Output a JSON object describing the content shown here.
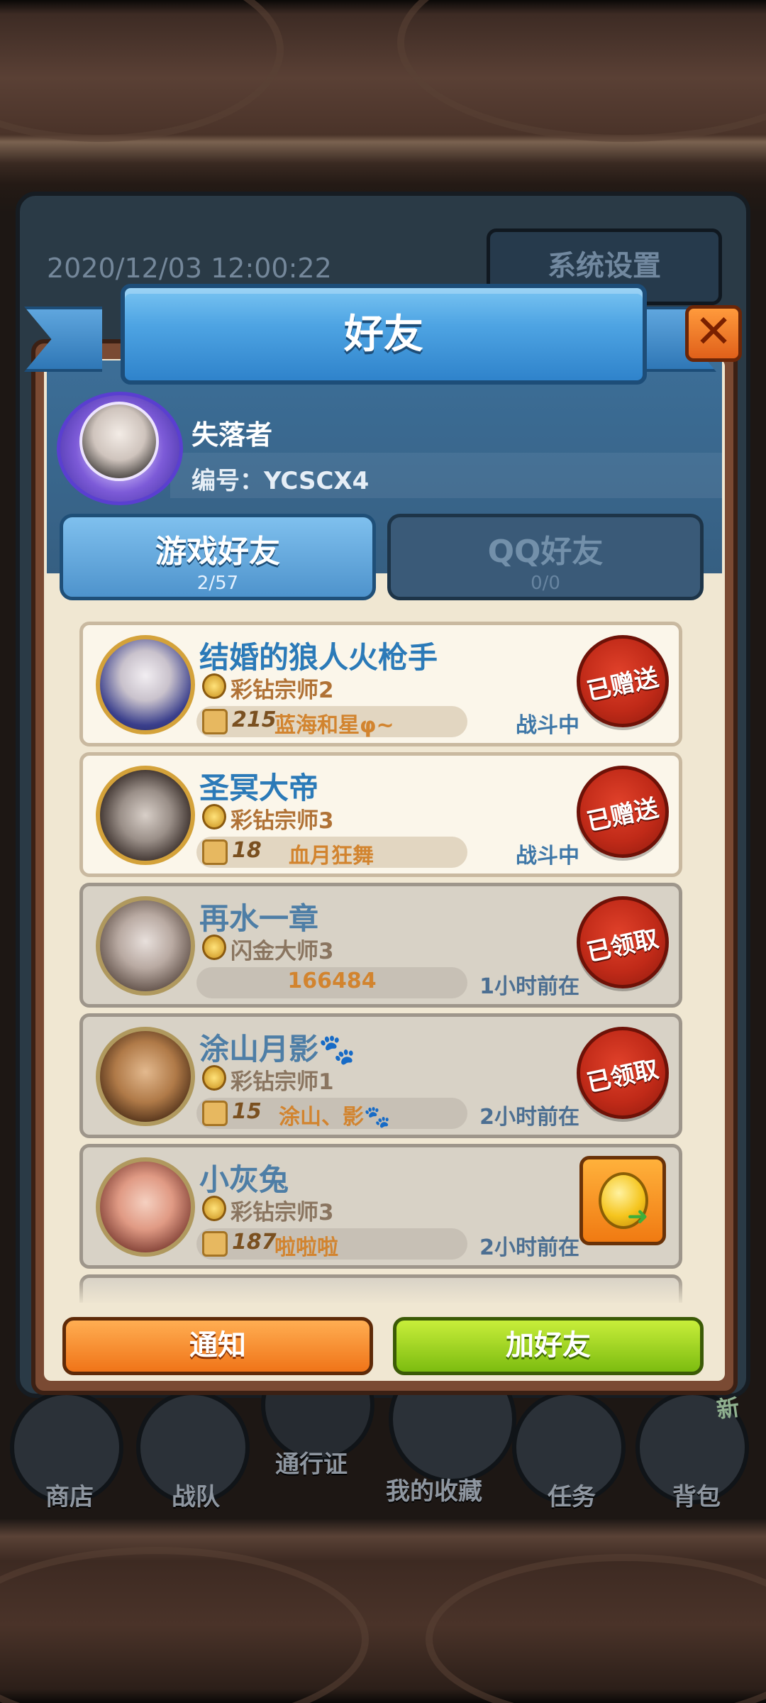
{
  "background": {
    "datetime": "2020/12/03 12:00:22",
    "settings_label": "系统设置",
    "nav": [
      {
        "label": "商店",
        "icon": "shop-icon"
      },
      {
        "label": "战队",
        "icon": "team-icon"
      },
      {
        "label": "通行证",
        "icon": "pass-icon"
      },
      {
        "label": "我的收藏",
        "icon": "collection-icon"
      },
      {
        "label": "任务",
        "icon": "task-icon"
      },
      {
        "label": "背包",
        "icon": "backpack-icon"
      }
    ],
    "new_badge": "新"
  },
  "dialog": {
    "title": "好友",
    "close_icon": "close-icon"
  },
  "profile": {
    "name": "失落者",
    "id_text": "编号：YCSCX4"
  },
  "tabs": [
    {
      "label": "游戏好友",
      "count": "2/57",
      "active": true
    },
    {
      "label": "QQ好友",
      "count": "0/0",
      "active": false
    }
  ],
  "friends": [
    {
      "name": "结婚的狼人火枪手",
      "rank": "彩钻宗师2",
      "likes": "215",
      "guild": "蓝海和星φ~",
      "status": "战斗中",
      "action": "已赠送",
      "online": true
    },
    {
      "name": "圣冥大帝",
      "rank": "彩钻宗师3",
      "likes": "18",
      "guild": "血月狂舞",
      "status": "战斗中",
      "action": "已赠送",
      "online": true
    },
    {
      "name": "再水一章",
      "rank": "闪金大师3",
      "likes": "",
      "guild": "166484",
      "status": "1小时前在",
      "action": "已领取",
      "online": false
    },
    {
      "name": "涂山月影🐾",
      "rank": "彩钻宗师1",
      "likes": "15",
      "guild": "涂山、影🐾",
      "status": "2小时前在",
      "action": "已领取",
      "online": false
    },
    {
      "name": "小灰兔",
      "rank": "彩钻宗师3",
      "likes": "187",
      "guild": "啦啦啦",
      "status": "2小时前在",
      "action": "coin",
      "online": false
    }
  ],
  "buttons": {
    "notify": "通知",
    "add_friend": "加好友"
  },
  "colors": {
    "ribbon_blue": "#4ea4e3",
    "seal_red": "#c02a18",
    "notify_orange": "#f07418",
    "add_green": "#7cbc10"
  }
}
